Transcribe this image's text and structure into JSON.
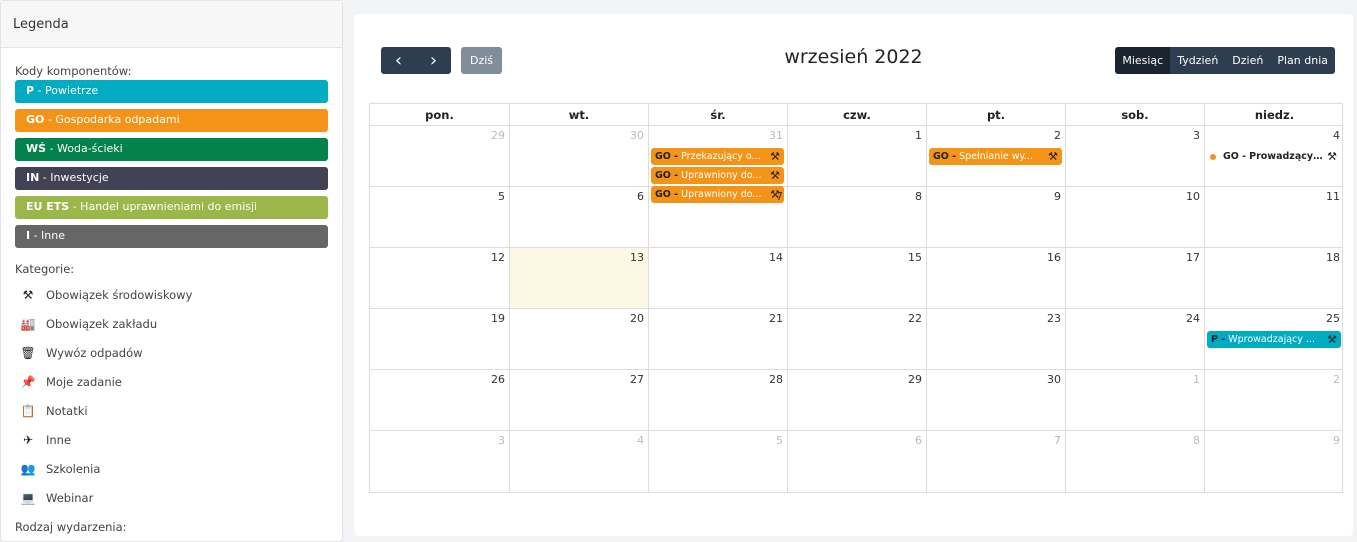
{
  "legend": {
    "header": "Legenda",
    "components_title": "Kody komponentów:",
    "components": [
      {
        "code": "P",
        "label": " - Powietrze",
        "color": "#00acc1"
      },
      {
        "code": "GO",
        "label": " - Gospodarka odpadami",
        "color": "#f39419"
      },
      {
        "code": "WŚ",
        "label": " - Woda-ścieki",
        "color": "#03824b"
      },
      {
        "code": "IN",
        "label": " - Inwestycje",
        "color": "#434254"
      },
      {
        "code": "EU ETS",
        "label": " - Handel uprawnieniami do emisji",
        "color": "#9bb74a"
      },
      {
        "code": "I",
        "label": " - Inne",
        "color": "#666666"
      }
    ],
    "categories_title": "Kategorie:",
    "categories": [
      {
        "icon": "gavel-icon",
        "glyph": "⚒",
        "label": "Obowiązek środowiskowy"
      },
      {
        "icon": "industry-icon",
        "glyph": "🏭",
        "label": "Obowiązek zakładu"
      },
      {
        "icon": "trash-icon",
        "glyph": "🗑",
        "label": "Wywóz odpadów"
      },
      {
        "icon": "thumbtack-icon",
        "glyph": "📌",
        "label": "Moje zadanie"
      },
      {
        "icon": "notes-icon",
        "glyph": "📋",
        "label": "Notatki"
      },
      {
        "icon": "rocket-icon",
        "glyph": "✈",
        "label": "Inne"
      },
      {
        "icon": "users-icon",
        "glyph": "👥",
        "label": "Szkolenia"
      },
      {
        "icon": "laptop-icon",
        "glyph": "💻",
        "label": "Webinar"
      }
    ],
    "event_type_title": "Rodzaj wydarzenia:"
  },
  "calendar": {
    "title": "wrzesień 2022",
    "today_label": "Dziś",
    "prev_glyph": "‹",
    "next_glyph": "›",
    "views": [
      "Miesiąc",
      "Tydzień",
      "Dzień",
      "Plan dnia"
    ],
    "active_view": "Miesiąc",
    "weekdays": [
      "pon.",
      "wt.",
      "śr.",
      "czw.",
      "pt.",
      "sob.",
      "niedz."
    ],
    "weeks": [
      [
        {
          "d": "29",
          "other": true
        },
        {
          "d": "30",
          "other": true
        },
        {
          "d": "31",
          "other": true
        },
        {
          "d": "1"
        },
        {
          "d": "2"
        },
        {
          "d": "3"
        },
        {
          "d": "4"
        }
      ],
      [
        {
          "d": "5"
        },
        {
          "d": "6"
        },
        {
          "d": "7"
        },
        {
          "d": "8"
        },
        {
          "d": "9"
        },
        {
          "d": "10"
        },
        {
          "d": "11"
        }
      ],
      [
        {
          "d": "12"
        },
        {
          "d": "13",
          "today": true
        },
        {
          "d": "14"
        },
        {
          "d": "15"
        },
        {
          "d": "16"
        },
        {
          "d": "17"
        },
        {
          "d": "18"
        }
      ],
      [
        {
          "d": "19"
        },
        {
          "d": "20"
        },
        {
          "d": "21"
        },
        {
          "d": "22"
        },
        {
          "d": "23"
        },
        {
          "d": "24"
        },
        {
          "d": "25"
        }
      ],
      [
        {
          "d": "26"
        },
        {
          "d": "27"
        },
        {
          "d": "28"
        },
        {
          "d": "29"
        },
        {
          "d": "30"
        },
        {
          "d": "1",
          "other": true
        },
        {
          "d": "2",
          "other": true
        }
      ],
      [
        {
          "d": "3",
          "other": true
        },
        {
          "d": "4",
          "other": true
        },
        {
          "d": "5",
          "other": true
        },
        {
          "d": "6",
          "other": true
        },
        {
          "d": "7",
          "other": true
        },
        {
          "d": "8",
          "other": true
        },
        {
          "d": "9",
          "other": true
        }
      ]
    ],
    "events": [
      {
        "week": 0,
        "day": 2,
        "code": "GO -",
        "text": "Przekazujący o...",
        "color": "#f39419",
        "style": "block",
        "icon": "gavel-icon"
      },
      {
        "week": 0,
        "day": 2,
        "code": "GO -",
        "text": "Uprawniony do...",
        "color": "#f39419",
        "style": "block",
        "icon": "gavel-icon"
      },
      {
        "week": 0,
        "day": 2,
        "code": "GO -",
        "text": "Uprawniony do...",
        "color": "#f39419",
        "style": "block",
        "icon": "gavel-icon"
      },
      {
        "week": 0,
        "day": 4,
        "code": "GO -",
        "text": "Spełnianie wy...",
        "color": "#f39419",
        "style": "block",
        "icon": "gavel-icon"
      },
      {
        "week": 0,
        "day": 6,
        "code": "GO -",
        "text": "Prowadzący ...",
        "color": "#f39419",
        "style": "dot",
        "icon": "gavel-icon"
      },
      {
        "week": 3,
        "day": 6,
        "code": "P -",
        "text": "Wprowadzający ...",
        "color": "#00acc1",
        "style": "block",
        "icon": "gavel-icon"
      }
    ]
  }
}
